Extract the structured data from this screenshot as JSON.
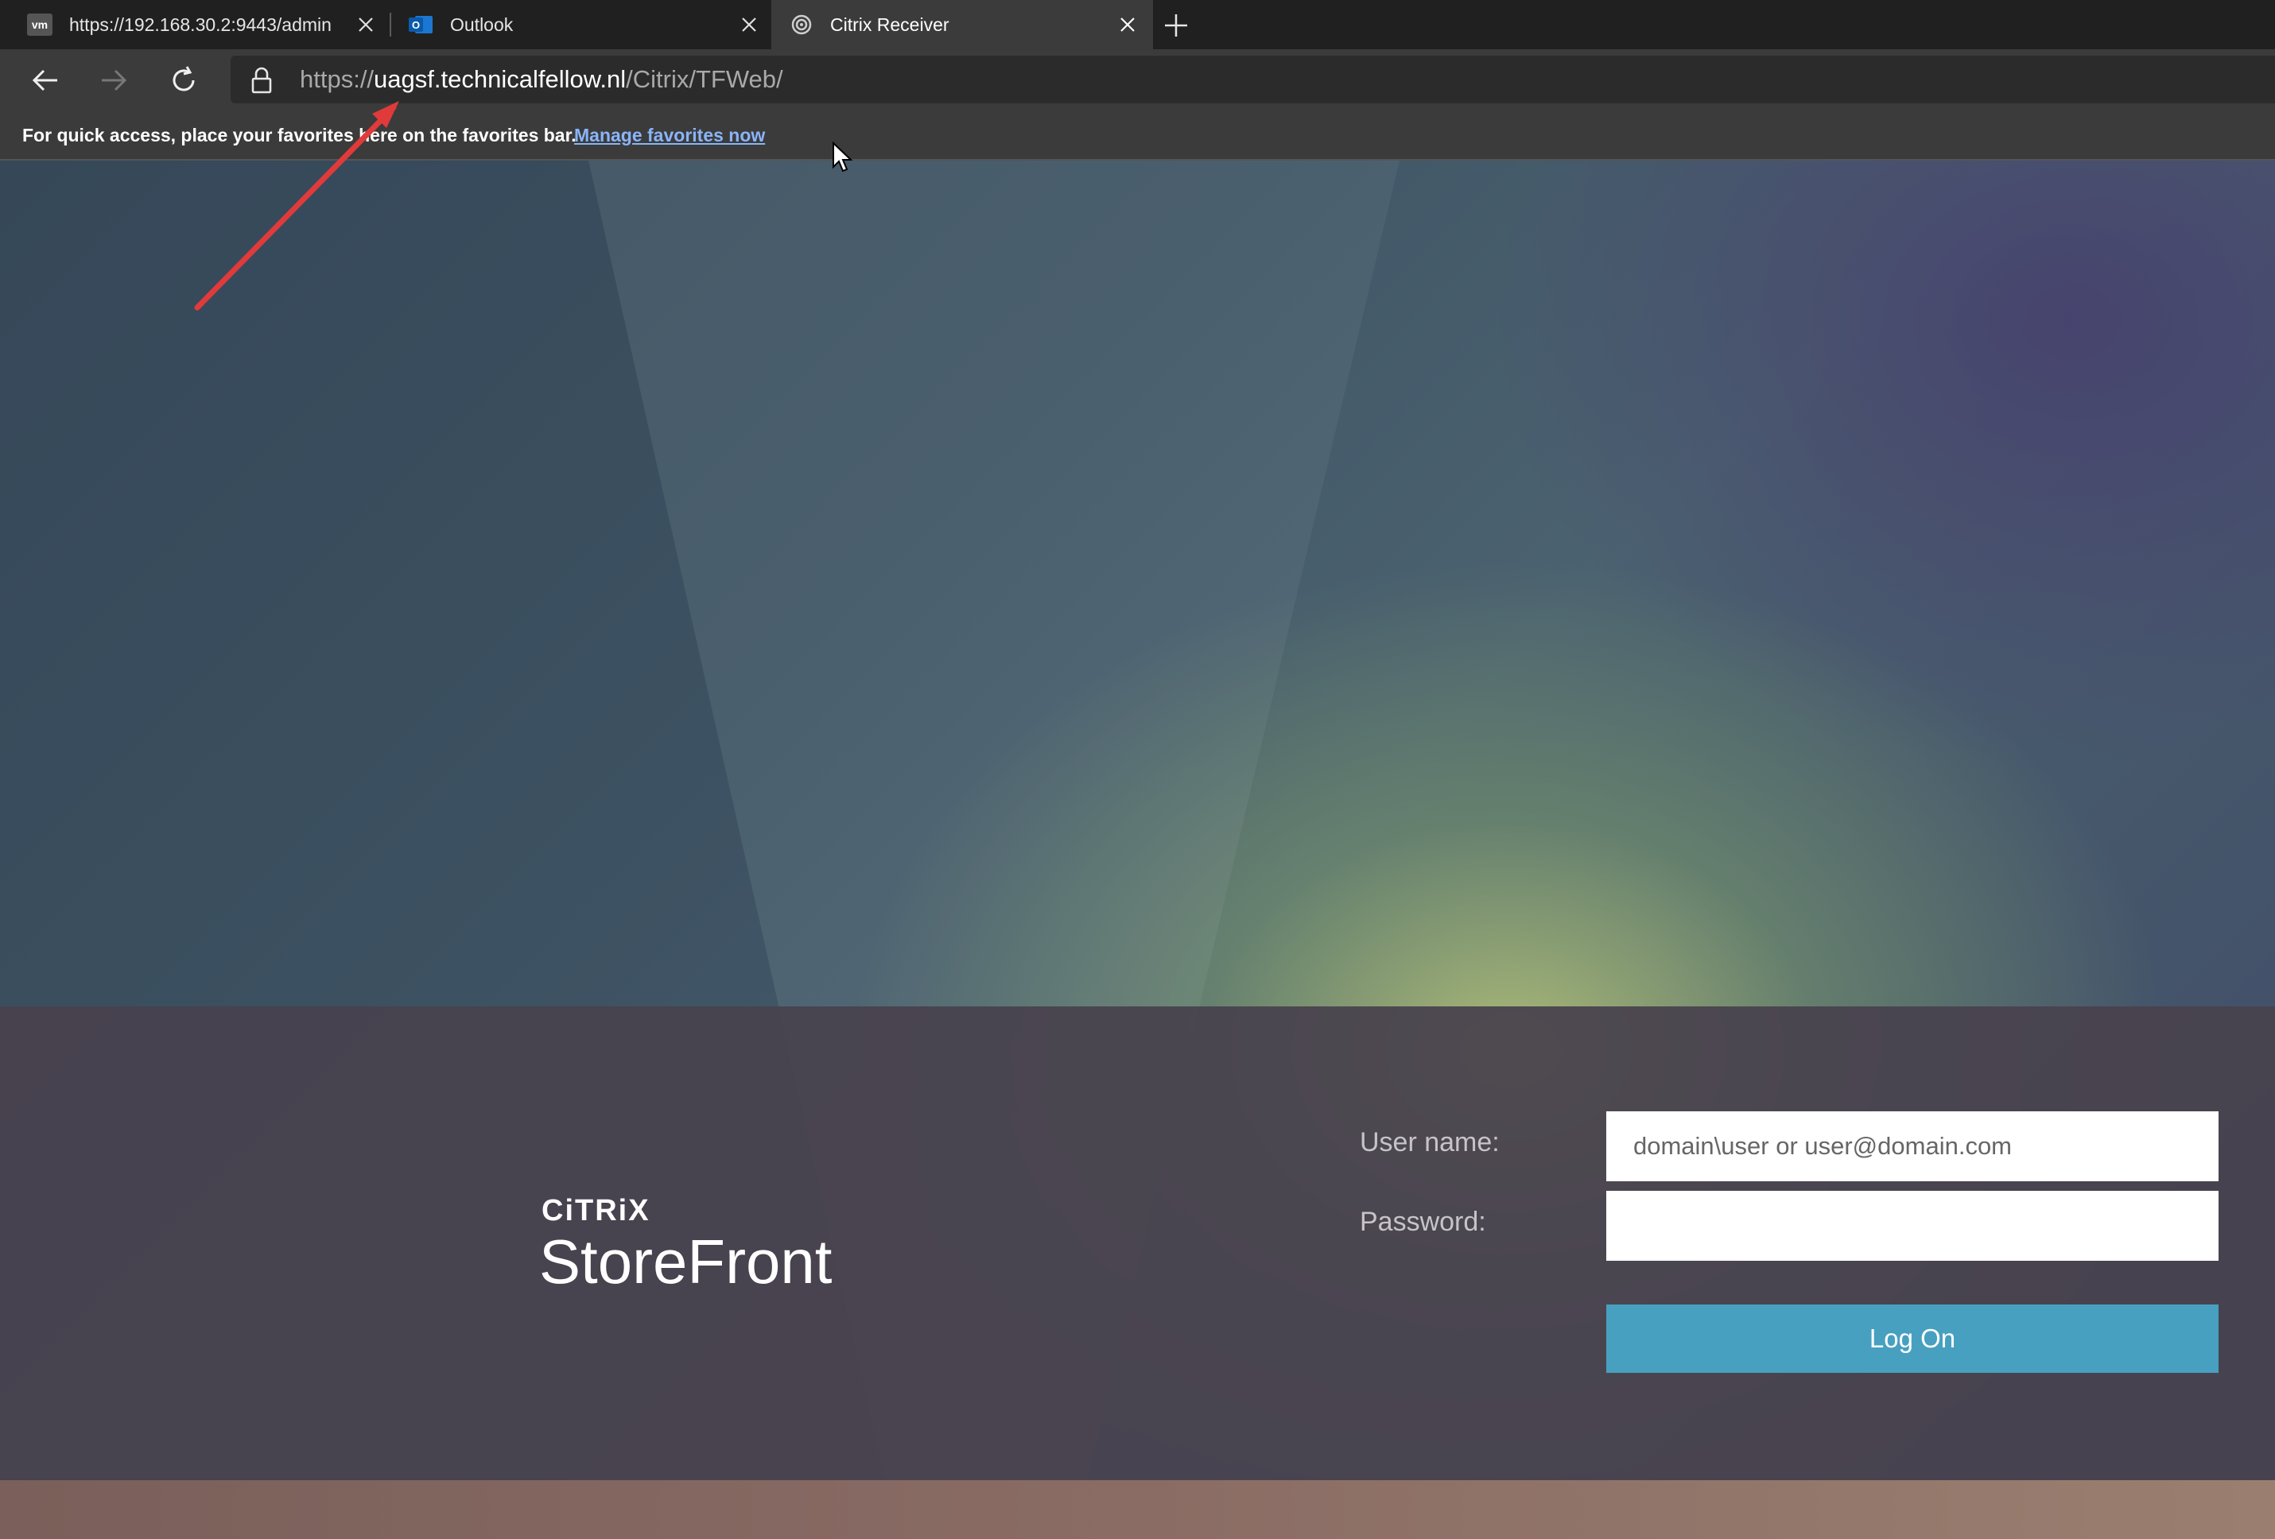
{
  "browser": {
    "tabs": [
      {
        "title": "https://192.168.30.2:9443/admin",
        "icon": "vmware-icon",
        "active": false
      },
      {
        "title": "Outlook",
        "icon": "outlook-icon",
        "active": false
      },
      {
        "title": "Citrix Receiver",
        "icon": "citrix-icon",
        "active": true
      }
    ],
    "address": {
      "scheme": "https://",
      "host": "uagsf.technicalfellow.nl",
      "path": "/Citrix/TFWeb/"
    },
    "favorites_bar": {
      "message": "For quick access, place your favorites here on the favorites bar.",
      "link": "Manage favorites now"
    }
  },
  "storefront": {
    "brand": "CiTRiX",
    "product": "StoreFront",
    "username_label": "User name:",
    "username_placeholder": "domain\\user or user@domain.com",
    "password_label": "Password:",
    "logon_label": "Log On",
    "accent_color": "#47a0c0"
  }
}
